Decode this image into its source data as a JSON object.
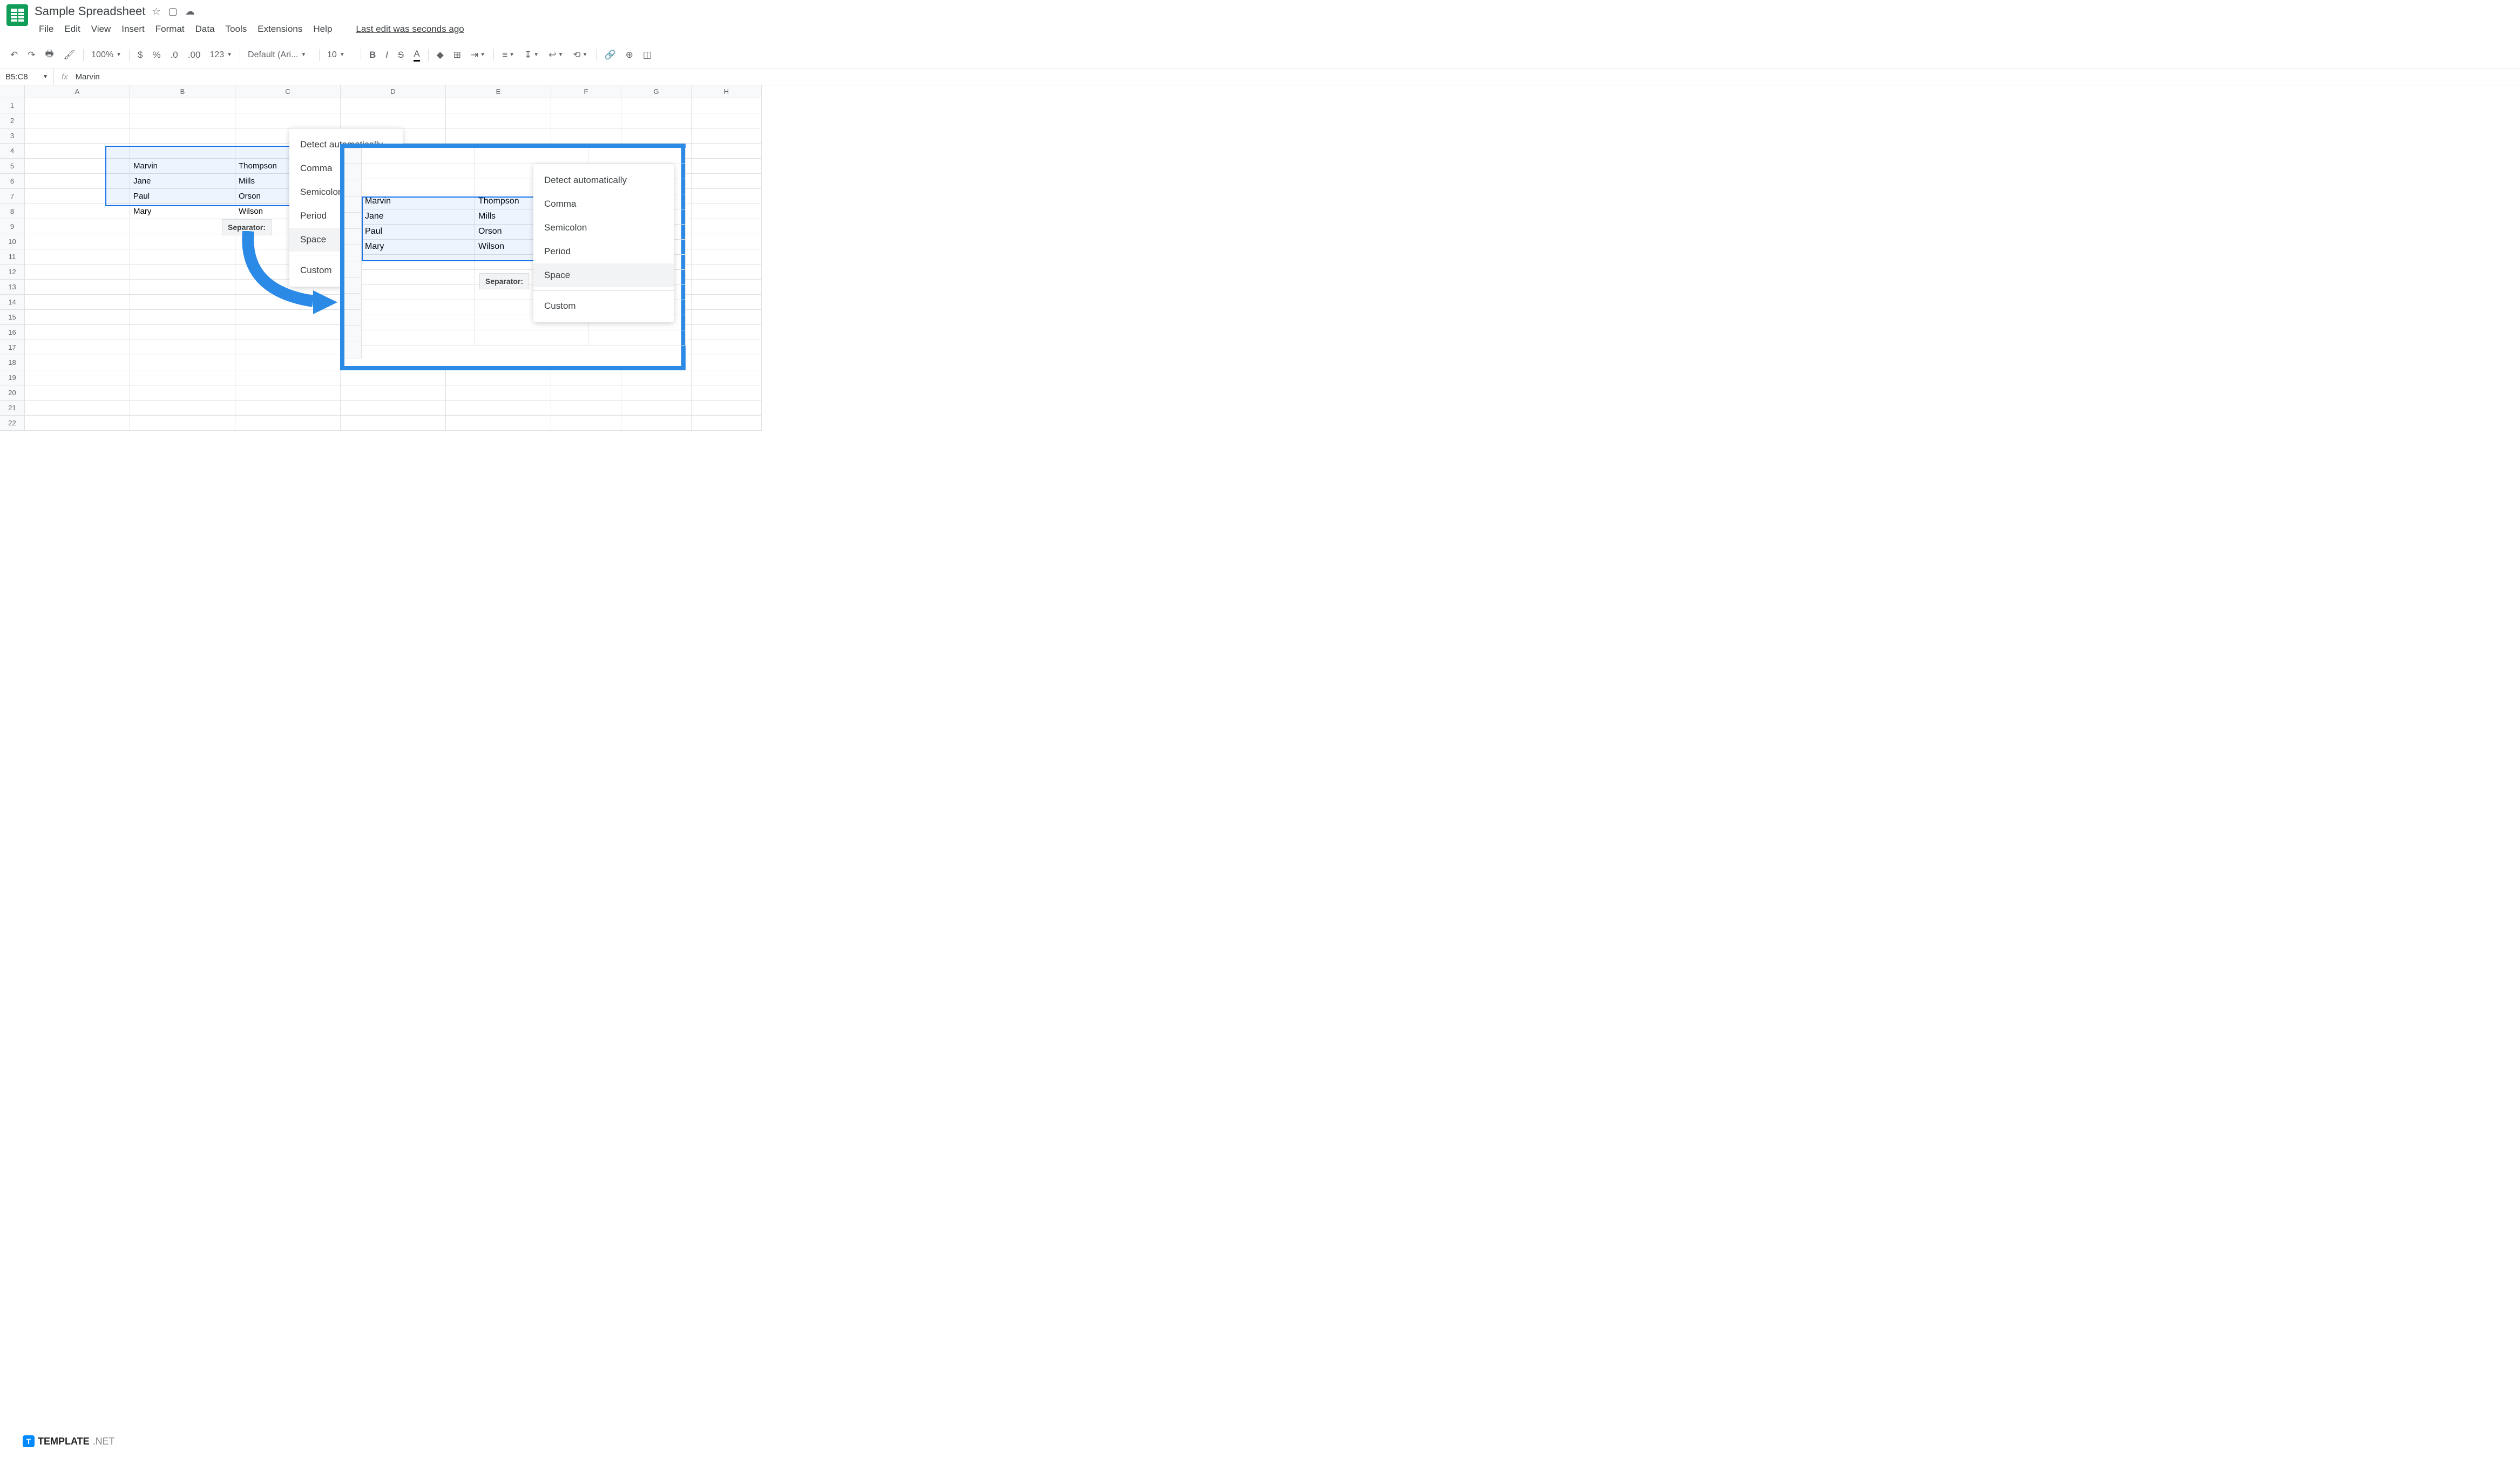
{
  "doc_title": "Sample Spreadsheet",
  "menus": [
    "File",
    "Edit",
    "View",
    "Insert",
    "Format",
    "Data",
    "Tools",
    "Extensions",
    "Help"
  ],
  "last_edit": "Last edit was seconds ago",
  "toolbar": {
    "zoom": "100%",
    "currency": "$",
    "percent": "%",
    "dec_dec": ".0",
    "dec_inc": ".00",
    "num_fmt": "123",
    "font": "Default (Ari...",
    "font_size": "10"
  },
  "name_box": "B5:C8",
  "formula_value": "Marvin",
  "columns": [
    "A",
    "B",
    "C",
    "D",
    "E",
    "F",
    "G",
    "H"
  ],
  "rows": [
    "1",
    "2",
    "3",
    "4",
    "5",
    "6",
    "7",
    "8",
    "9",
    "10",
    "11",
    "12",
    "13",
    "14",
    "15",
    "16",
    "17",
    "18",
    "19",
    "20",
    "21",
    "22"
  ],
  "data": {
    "b5": "Marvin",
    "c5": "Thompson",
    "b6": "Jane",
    "c6": "Mills",
    "b7": "Paul",
    "c7": "Orson",
    "b8": "Mary",
    "c8": "Wilson"
  },
  "separator_label": "Separator:",
  "dropdown_items": [
    "Detect automatically",
    "Comma",
    "Semicolon",
    "Period",
    "Space",
    "Custom"
  ],
  "callout": {
    "data": {
      "b5": "Marvin",
      "c5": "Thompson",
      "b6": "Jane",
      "c6": "Mills",
      "b7": "Paul",
      "c7": "Orson",
      "b8": "Mary",
      "c8": "Wilson"
    },
    "separator_label": "Separator:"
  },
  "watermark": {
    "brand": "TEMPLATE",
    "suffix": ".NET"
  }
}
